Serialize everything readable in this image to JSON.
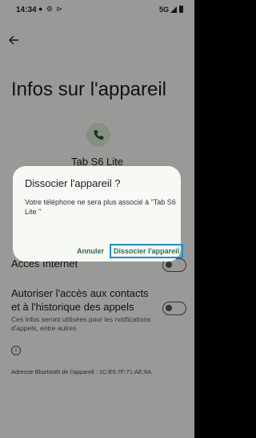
{
  "status_bar": {
    "time": "14:34",
    "left_icons": "● ⚙ ⊳",
    "network": "5G"
  },
  "page": {
    "title": "Infos sur l'appareil",
    "device_name": "Tab S6 Lite",
    "hidden_row_label": "Accès Internet",
    "contacts_row": {
      "label": "Autoriser l'accès aux contacts et à l'historique des appels",
      "sub": "Ces infos seront utilisées pour les notifications d'appels, entre autres"
    },
    "bluetooth_address": "Adresse Bluetooth de l'appareil : 1C:E5:7F:71:AE:6A"
  },
  "dialog": {
    "title": "Dissocier l'appareil ?",
    "body": "Votre téléphone ne sera plus associé à \"Tab S6 Lite                    \"",
    "cancel_label": "Annuler",
    "confirm_label": "Dissocier l'appareil"
  },
  "colors": {
    "accent": "#2e6b5e",
    "focus_outline": "#1a8fd6",
    "background": "#f7f9f4"
  }
}
